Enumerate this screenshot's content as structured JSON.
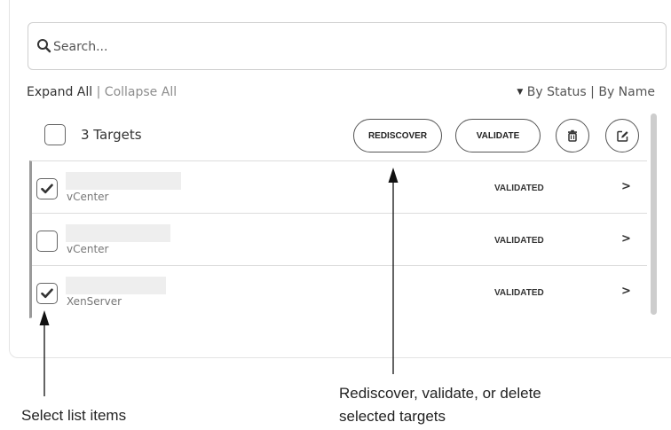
{
  "search": {
    "placeholder": "Search..."
  },
  "controls": {
    "expand_all": "Expand All",
    "separator": "|",
    "collapse_all": "Collapse All",
    "sort_caret": "▼",
    "by_status": "By Status",
    "sort_separator": "|",
    "by_name": "By Name"
  },
  "header": {
    "targets_count": "3 Targets",
    "rediscover_label": "REDISCOVER",
    "validate_label": "VALIDATE",
    "delete_icon": "trash-icon",
    "edit_icon": "edit-icon"
  },
  "rows": [
    {
      "type": "vCenter",
      "status": "VALIDATED",
      "checked": true
    },
    {
      "type": "vCenter",
      "status": "VALIDATED",
      "checked": false
    },
    {
      "type": "XenServer",
      "status": "VALIDATED",
      "checked": true
    }
  ],
  "annotations": {
    "left": "Select list items",
    "right_line1": "Rediscover, validate, or delete",
    "right_line2": "selected targets"
  }
}
